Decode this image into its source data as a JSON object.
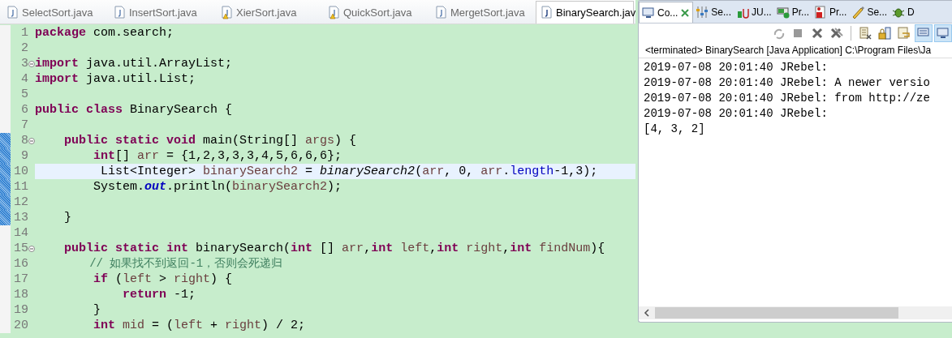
{
  "editor": {
    "tabs": [
      {
        "label": "SelectSort.java",
        "selected": false,
        "warning": false
      },
      {
        "label": "InsertSort.java",
        "selected": false,
        "warning": false
      },
      {
        "label": "XierSort.java",
        "selected": false,
        "warning": true
      },
      {
        "label": "QuickSort.java",
        "selected": false,
        "warning": true
      },
      {
        "label": "MergetSort.java",
        "selected": false,
        "warning": false
      },
      {
        "label": "BinarySearch.jav",
        "selected": true,
        "warning": false
      }
    ],
    "lines": [
      {
        "number": "1",
        "fold": false,
        "changed": false,
        "current": false,
        "segments": [
          {
            "kind": "keyword",
            "text": "package"
          },
          {
            "kind": "plain",
            "text": " com.search;"
          }
        ]
      },
      {
        "number": "2",
        "fold": false,
        "changed": false,
        "current": false
      },
      {
        "number": "3",
        "fold": true,
        "changed": false,
        "current": false,
        "segments": [
          {
            "kind": "keyword",
            "text": "import"
          },
          {
            "kind": "plain",
            "text": " java.util.ArrayList;"
          }
        ]
      },
      {
        "number": "4",
        "fold": false,
        "changed": false,
        "current": false,
        "segments": [
          {
            "kind": "keyword",
            "text": "import"
          },
          {
            "kind": "plain",
            "text": " java.util.List;"
          }
        ]
      },
      {
        "number": "5",
        "fold": false,
        "changed": false,
        "current": false
      },
      {
        "number": "6",
        "fold": false,
        "changed": false,
        "current": false,
        "segments": [
          {
            "kind": "keyword",
            "text": "public"
          },
          {
            "kind": "keyword",
            "text": " class"
          },
          {
            "kind": "plain",
            "text": " BinarySearch {"
          }
        ]
      },
      {
        "number": "7",
        "fold": false,
        "changed": false,
        "current": false
      },
      {
        "number": "8",
        "fold": true,
        "changed": true,
        "current": false,
        "segments": [
          {
            "kind": "keyword",
            "text": "    public"
          },
          {
            "kind": "keyword",
            "text": " static"
          },
          {
            "kind": "keyword",
            "text": " void"
          },
          {
            "kind": "plain",
            "text": " main(String[] "
          },
          {
            "kind": "local",
            "text": "args"
          },
          {
            "kind": "plain",
            "text": ") {"
          }
        ]
      },
      {
        "number": "9",
        "fold": false,
        "changed": true,
        "current": false,
        "segments": [
          {
            "kind": "keyword",
            "text": "        int"
          },
          {
            "kind": "plain",
            "text": "[] "
          },
          {
            "kind": "local",
            "text": "arr"
          },
          {
            "kind": "plain",
            "text": " = {1,2,3,3,3,4,5,6,6,6};"
          }
        ]
      },
      {
        "number": "10",
        "fold": false,
        "changed": true,
        "current": true,
        "segments": [
          {
            "kind": "plain",
            "text": "         List<Integer> "
          },
          {
            "kind": "local",
            "text": "binarySearch2"
          },
          {
            "kind": "plain",
            "text": " = "
          },
          {
            "kind": "static-call",
            "text": "binarySearch2"
          },
          {
            "kind": "plain",
            "text": "("
          },
          {
            "kind": "local",
            "text": "arr"
          },
          {
            "kind": "plain",
            "text": ", 0, "
          },
          {
            "kind": "local",
            "text": "arr"
          },
          {
            "kind": "plain",
            "text": "."
          },
          {
            "kind": "field",
            "text": "length"
          },
          {
            "kind": "plain",
            "text": "-1,3);"
          }
        ]
      },
      {
        "number": "11",
        "fold": false,
        "changed": true,
        "current": false,
        "segments": [
          {
            "kind": "plain",
            "text": "        System."
          },
          {
            "kind": "static-field",
            "text": "out"
          },
          {
            "kind": "plain",
            "text": ".println("
          },
          {
            "kind": "local",
            "text": "binarySearch2"
          },
          {
            "kind": "plain",
            "text": ");"
          }
        ]
      },
      {
        "number": "12",
        "fold": false,
        "changed": true,
        "current": false
      },
      {
        "number": "13",
        "fold": false,
        "changed": true,
        "current": false,
        "segments": [
          {
            "kind": "plain",
            "text": "    }"
          }
        ]
      },
      {
        "number": "14",
        "fold": false,
        "changed": false,
        "current": false
      },
      {
        "number": "15",
        "fold": true,
        "changed": false,
        "current": false,
        "segments": [
          {
            "kind": "keyword",
            "text": "    public"
          },
          {
            "kind": "keyword",
            "text": " static"
          },
          {
            "kind": "keyword",
            "text": " int"
          },
          {
            "kind": "plain",
            "text": " binarySearch("
          },
          {
            "kind": "keyword",
            "text": "int"
          },
          {
            "kind": "plain",
            "text": " [] "
          },
          {
            "kind": "local",
            "text": "arr"
          },
          {
            "kind": "plain",
            "text": ","
          },
          {
            "kind": "keyword",
            "text": "int"
          },
          {
            "kind": "local",
            "text": " left"
          },
          {
            "kind": "plain",
            "text": ","
          },
          {
            "kind": "keyword",
            "text": "int"
          },
          {
            "kind": "local",
            "text": " right"
          },
          {
            "kind": "plain",
            "text": ","
          },
          {
            "kind": "keyword",
            "text": "int"
          },
          {
            "kind": "local",
            "text": " findNum"
          },
          {
            "kind": "plain",
            "text": "){"
          }
        ]
      },
      {
        "number": "16",
        "fold": false,
        "changed": false,
        "current": false,
        "segments": [
          {
            "kind": "comment",
            "text": "        // 如果找不到返回-1，否则会死递归"
          }
        ]
      },
      {
        "number": "17",
        "fold": false,
        "changed": false,
        "current": false,
        "segments": [
          {
            "kind": "keyword",
            "text": "        if"
          },
          {
            "kind": "plain",
            "text": " ("
          },
          {
            "kind": "local",
            "text": "left"
          },
          {
            "kind": "plain",
            "text": " > "
          },
          {
            "kind": "local",
            "text": "right"
          },
          {
            "kind": "plain",
            "text": ") {"
          }
        ]
      },
      {
        "number": "18",
        "fold": false,
        "changed": false,
        "current": false,
        "segments": [
          {
            "kind": "keyword",
            "text": "            return"
          },
          {
            "kind": "plain",
            "text": " -1;"
          }
        ]
      },
      {
        "number": "19",
        "fold": false,
        "changed": false,
        "current": false,
        "segments": [
          {
            "kind": "plain",
            "text": "        }"
          }
        ]
      },
      {
        "number": "20",
        "fold": false,
        "changed": false,
        "current": false,
        "segments": [
          {
            "kind": "keyword",
            "text": "        int"
          },
          {
            "kind": "local",
            "text": " mid"
          },
          {
            "kind": "plain",
            "text": " = ("
          },
          {
            "kind": "local",
            "text": "left"
          },
          {
            "kind": "plain",
            "text": " + "
          },
          {
            "kind": "local",
            "text": "right"
          },
          {
            "kind": "plain",
            "text": ") / 2;"
          }
        ]
      }
    ]
  },
  "console": {
    "tabs": [
      {
        "label": "Co...",
        "selected": true,
        "closable": true
      },
      {
        "label": "Se...",
        "selected": false,
        "closable": false
      },
      {
        "label": "JU...",
        "selected": false,
        "closable": false
      },
      {
        "label": "Pr...",
        "selected": false,
        "closable": false
      },
      {
        "label": "Pr...",
        "selected": false,
        "closable": false
      },
      {
        "label": "Se...",
        "selected": false,
        "closable": false
      },
      {
        "label": "D",
        "selected": false,
        "closable": false
      }
    ],
    "status": "<terminated> BinarySearch [Java Application] C:\\Program Files\\Ja",
    "output": [
      "2019-07-08 20:01:40 JRebel:",
      "2019-07-08 20:01:40 JRebel: A newer versio",
      "2019-07-08 20:01:40 JRebel: from http://ze",
      "2019-07-08 20:01:40 JRebel:",
      "[4, 3, 2]"
    ]
  }
}
